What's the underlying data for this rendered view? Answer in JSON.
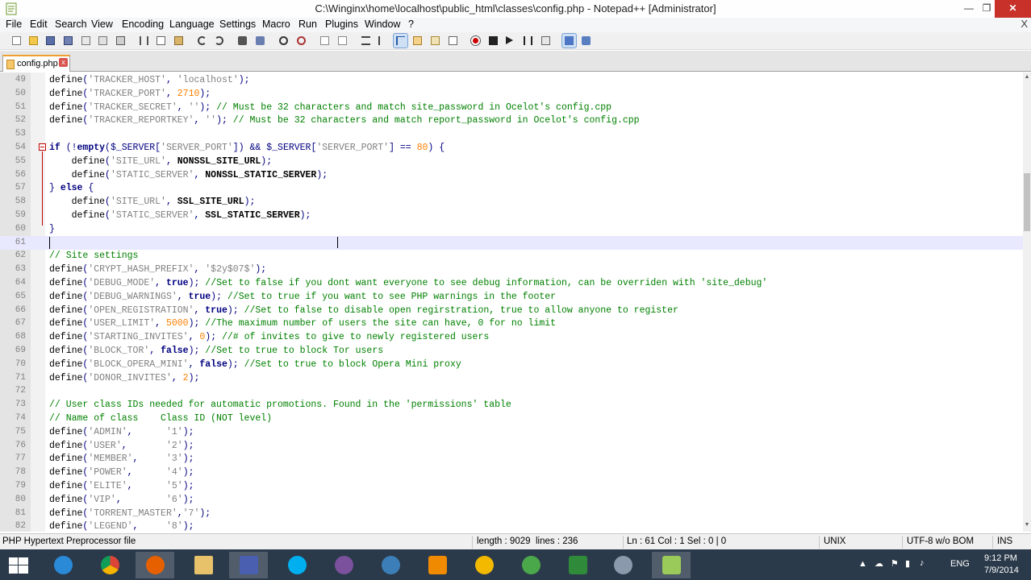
{
  "window": {
    "title": "C:\\Winginx\\home\\localhost\\public_html\\classes\\config.php - Notepad++ [Administrator]",
    "minimize": "—",
    "maximize": "❐",
    "close": "✕"
  },
  "menu": {
    "items": [
      "File",
      "Edit",
      "Search",
      "View",
      "Encoding",
      "Language",
      "Settings",
      "Macro",
      "Run",
      "Plugins",
      "Window",
      "?"
    ],
    "close_doc": "X"
  },
  "tab": {
    "label": "config.php",
    "close": "x"
  },
  "editor": {
    "current_line": 61,
    "lines": [
      {
        "n": "49",
        "t": "define('TRACKER_HOST', 'localhost');"
      },
      {
        "n": "50",
        "t": "define('TRACKER_PORT', 2710);"
      },
      {
        "n": "51",
        "t": "define('TRACKER_SECRET', ''); // Must be 32 characters and match site_password in Ocelot's config.cpp"
      },
      {
        "n": "52",
        "t": "define('TRACKER_REPORTKEY', ''); // Must be 32 characters and match report_password in Ocelot's config.cpp"
      },
      {
        "n": "53",
        "t": ""
      },
      {
        "n": "54",
        "t": "if (!empty($_SERVER['SERVER_PORT']) && $_SERVER['SERVER_PORT'] == 80) {"
      },
      {
        "n": "55",
        "t": "    define('SITE_URL', NONSSL_SITE_URL);"
      },
      {
        "n": "56",
        "t": "    define('STATIC_SERVER', NONSSL_STATIC_SERVER);"
      },
      {
        "n": "57",
        "t": "} else {"
      },
      {
        "n": "58",
        "t": "    define('SITE_URL', SSL_SITE_URL);"
      },
      {
        "n": "59",
        "t": "    define('STATIC_SERVER', SSL_STATIC_SERVER);"
      },
      {
        "n": "60",
        "t": "}"
      },
      {
        "n": "61",
        "t": ""
      },
      {
        "n": "62",
        "t": "// Site settings"
      },
      {
        "n": "63",
        "t": "define('CRYPT_HASH_PREFIX', '$2y$07$');"
      },
      {
        "n": "64",
        "t": "define('DEBUG_MODE', true); //Set to false if you dont want everyone to see debug information, can be overriden with 'site_debug'"
      },
      {
        "n": "65",
        "t": "define('DEBUG_WARNINGS', true); //Set to true if you want to see PHP warnings in the footer"
      },
      {
        "n": "66",
        "t": "define('OPEN_REGISTRATION', true); //Set to false to disable open regirstration, true to allow anyone to register"
      },
      {
        "n": "67",
        "t": "define('USER_LIMIT', 5000); //The maximum number of users the site can have, 0 for no limit"
      },
      {
        "n": "68",
        "t": "define('STARTING_INVITES', 0); //# of invites to give to newly registered users"
      },
      {
        "n": "69",
        "t": "define('BLOCK_TOR', false); //Set to true to block Tor users"
      },
      {
        "n": "70",
        "t": "define('BLOCK_OPERA_MINI', false); //Set to true to block Opera Mini proxy"
      },
      {
        "n": "71",
        "t": "define('DONOR_INVITES', 2);"
      },
      {
        "n": "72",
        "t": ""
      },
      {
        "n": "73",
        "t": "// User class IDs needed for automatic promotions. Found in the 'permissions' table"
      },
      {
        "n": "74",
        "t": "// Name of class    Class ID (NOT level)"
      },
      {
        "n": "75",
        "t": "define('ADMIN',      '1');"
      },
      {
        "n": "76",
        "t": "define('USER',       '2');"
      },
      {
        "n": "77",
        "t": "define('MEMBER',     '3');"
      },
      {
        "n": "78",
        "t": "define('POWER',      '4');"
      },
      {
        "n": "79",
        "t": "define('ELITE',      '5');"
      },
      {
        "n": "80",
        "t": "define('VIP',        '6');"
      },
      {
        "n": "81",
        "t": "define('TORRENT_MASTER','7');"
      },
      {
        "n": "82",
        "t": "define('LEGEND',     '8');"
      }
    ]
  },
  "status": {
    "file_type": "PHP Hypertext Preprocessor file",
    "length": "length : 9029",
    "lines": "lines : 236",
    "position": "Ln : 61    Col : 1    Sel : 0 | 0",
    "eol": "UNIX",
    "encoding": "UTF-8 w/o BOM",
    "mode": "INS"
  },
  "taskbar": {
    "language": "ENG",
    "time": "9:12 PM",
    "date": "7/9/2014"
  },
  "colors": {
    "title_close": "#c7312a",
    "current_line": "#e8e8ff",
    "keyword": "#000080",
    "comment": "#008000",
    "string": "#808080",
    "number": "#ff8000",
    "taskbar": "#2b3a4a"
  }
}
